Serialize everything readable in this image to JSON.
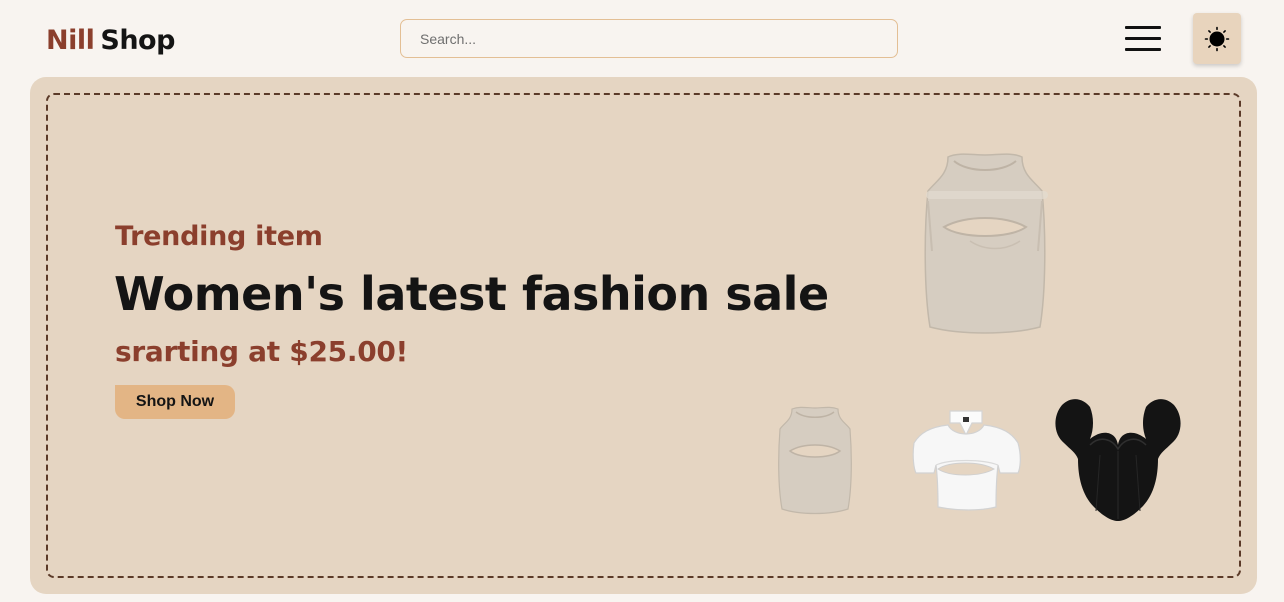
{
  "header": {
    "logo_first": "Nill",
    "logo_second": "Shop",
    "search_placeholder": "Search...",
    "menu_icon": "hamburger-menu-icon",
    "theme_icon": "sun-icon"
  },
  "hero": {
    "subtitle": "Trending item",
    "title": "Women's latest fashion sale",
    "price_text": "srarting at $25.00!",
    "cta_label": "Shop Now",
    "products": [
      {
        "name": "beige cutout crop tank top",
        "color": "#d6cdc1"
      },
      {
        "name": "beige cutout crop tank top",
        "color": "#d6cdc1"
      },
      {
        "name": "white short-sleeve halter crop top",
        "color": "#f7f7f7"
      },
      {
        "name": "black puff-sleeve corset top",
        "color": "#141414"
      }
    ]
  },
  "colors": {
    "background": "#f8f4f0",
    "hero_background": "#e5d5c2",
    "brand_brown": "#8b3f2d",
    "cta": "#e3b585",
    "theme_button": "#e8d4bd"
  }
}
